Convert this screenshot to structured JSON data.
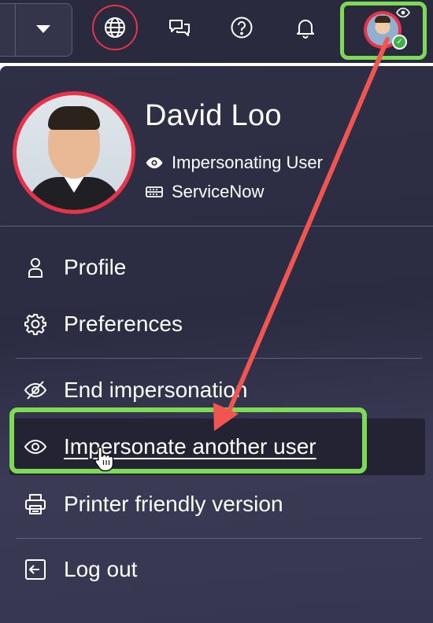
{
  "header": {
    "icons": [
      "chevron-down-icon",
      "globe-icon",
      "chat-icon",
      "help-icon",
      "bell-icon",
      "user-avatar"
    ],
    "highlight_colors": {
      "globe_ring": "#e8334a",
      "avatar_box": "#7ed957"
    }
  },
  "profile": {
    "name": "David Loo",
    "status": "Impersonating User",
    "company": "ServiceNow"
  },
  "menu": {
    "profile": "Profile",
    "preferences": "Preferences",
    "end_impersonation": "End impersonation",
    "impersonate_another": "Impersonate another user",
    "printer_friendly": "Printer friendly version",
    "log_out": "Log out"
  },
  "colors": {
    "panel_bg": "#2f2f46",
    "accent_red": "#e8334a",
    "callout_green": "#7ed957",
    "arrow": "#f0564f"
  }
}
